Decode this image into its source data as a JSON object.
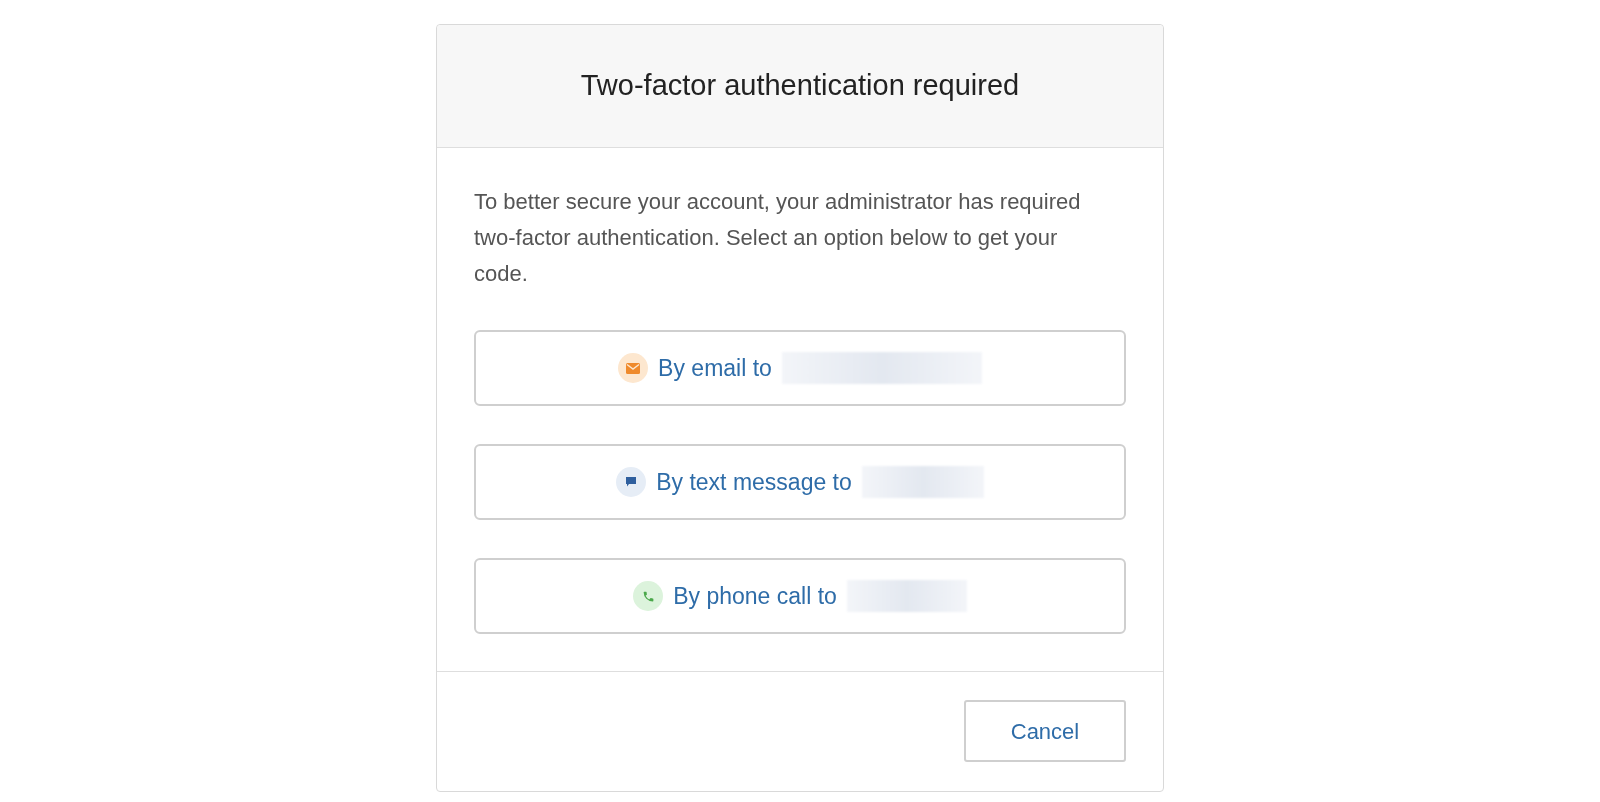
{
  "dialog": {
    "title": "Two-factor authentication required",
    "message": "To better secure your account, your administrator has required two-factor authentication. Select an option below to get your code.",
    "options": [
      {
        "kind": "email",
        "label": "By email to",
        "redacted": true
      },
      {
        "kind": "text",
        "label": "By text message to",
        "redacted": true
      },
      {
        "kind": "phone",
        "label": "By phone call to",
        "redacted": true
      }
    ],
    "cancel_button": "Cancel"
  }
}
